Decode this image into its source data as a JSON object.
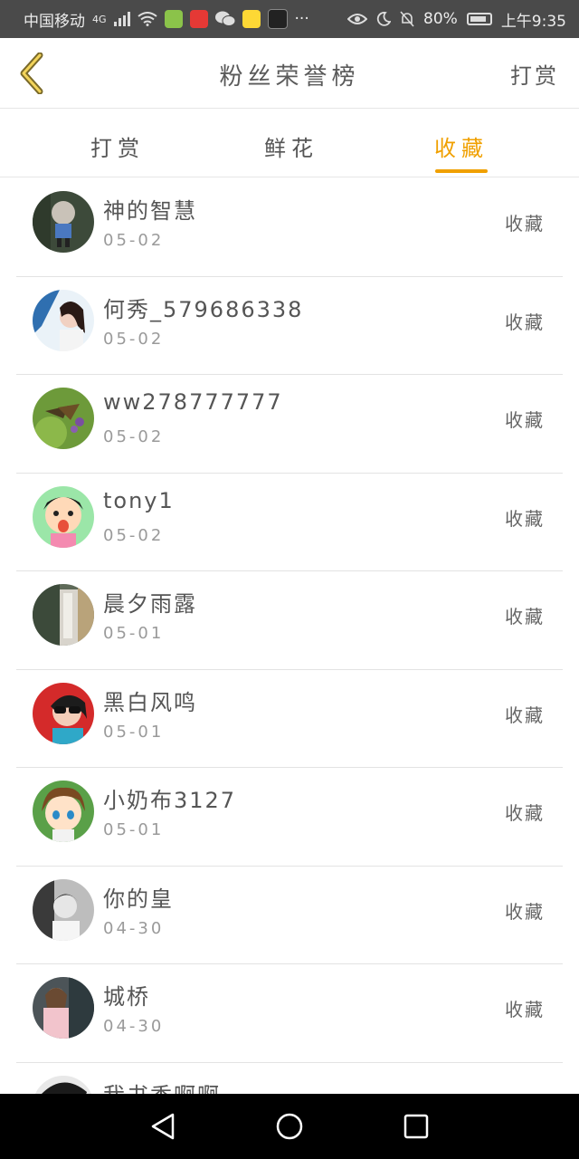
{
  "status_bar": {
    "carrier": "中国移动",
    "network": "4G",
    "battery": "80%",
    "time": "上午9:35",
    "more": "···"
  },
  "header": {
    "title": "粉丝荣誉榜",
    "action": "打赏"
  },
  "tabs": [
    {
      "label": "打赏"
    },
    {
      "label": "鲜花"
    },
    {
      "label": "收藏"
    }
  ],
  "active_tab": "收藏",
  "accent_color": "#f0a000",
  "fans": [
    {
      "name": "神的智慧",
      "date": "05-02",
      "type": "收藏"
    },
    {
      "name": "何秀_579686338",
      "date": "05-02",
      "type": "收藏"
    },
    {
      "name": "ww278777777",
      "date": "05-02",
      "type": "收藏"
    },
    {
      "name": "tony1",
      "date": "05-02",
      "type": "收藏"
    },
    {
      "name": "晨夕雨露",
      "date": "05-01",
      "type": "收藏"
    },
    {
      "name": "黑白风鸣",
      "date": "05-01",
      "type": "收藏"
    },
    {
      "name": "小奶布3127",
      "date": "05-01",
      "type": "收藏"
    },
    {
      "name": "你的皇",
      "date": "04-30",
      "type": "收藏"
    },
    {
      "name": "城桥",
      "date": "04-30",
      "type": "收藏"
    },
    {
      "name": "我书香啊啊",
      "date": "",
      "type": ""
    }
  ]
}
